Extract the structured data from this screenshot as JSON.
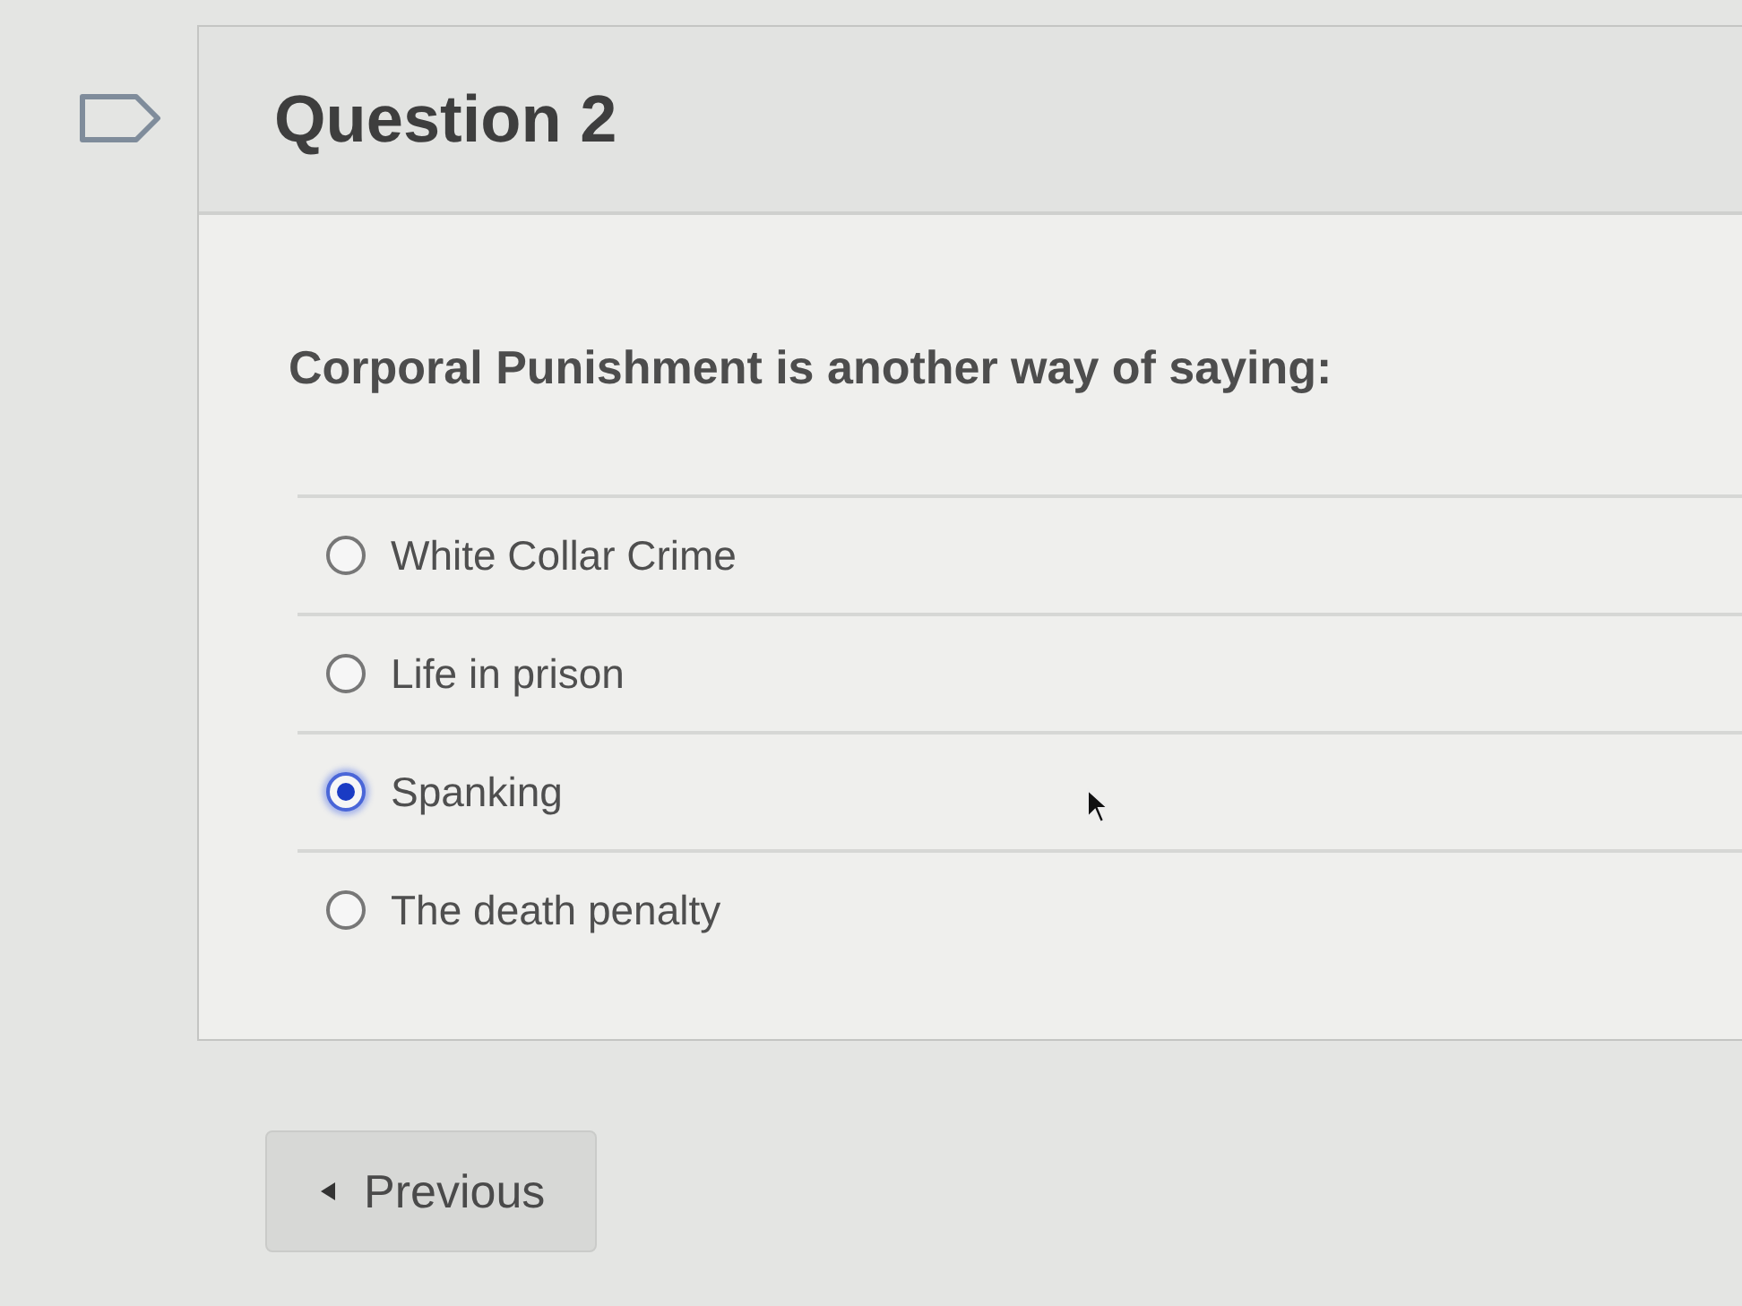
{
  "flag": {
    "flagged": false
  },
  "question": {
    "title": "Question 2",
    "prompt": "Corporal Punishment is another way of saying:",
    "options": [
      {
        "label": "White Collar Crime",
        "selected": false
      },
      {
        "label": "Life in prison",
        "selected": false
      },
      {
        "label": "Spanking",
        "selected": true
      },
      {
        "label": "The death penalty",
        "selected": false
      }
    ]
  },
  "navigation": {
    "previous": "Previous"
  }
}
